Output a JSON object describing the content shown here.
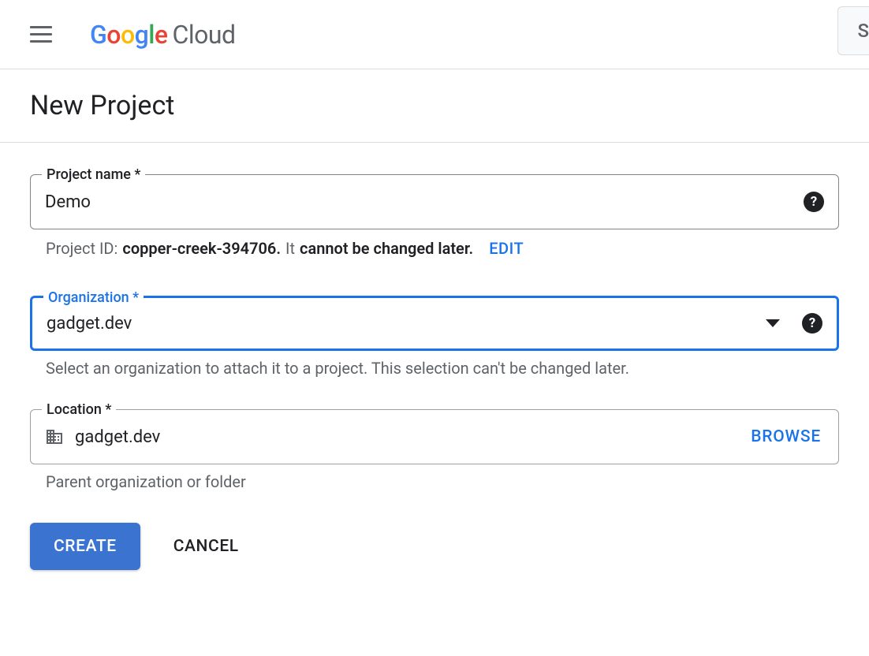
{
  "header": {
    "product_name_cloud": "Cloud",
    "right_button_glyph": "S"
  },
  "page": {
    "title": "New Project"
  },
  "fields": {
    "project_name": {
      "label": "Project name *",
      "value": "Demo"
    },
    "project_id": {
      "prefix": "Project ID:",
      "value": "copper-creek-394706",
      "dot": ".",
      "it": "It",
      "cannot": "cannot be changed later.",
      "edit_label": "EDIT"
    },
    "organization": {
      "label": "Organization *",
      "value": "gadget.dev",
      "helper": "Select an organization to attach it to a project. This selection can't be changed later."
    },
    "location": {
      "label": "Location *",
      "value": "gadget.dev",
      "browse_label": "BROWSE",
      "helper": "Parent organization or folder"
    }
  },
  "actions": {
    "create": "CREATE",
    "cancel": "CANCEL"
  }
}
